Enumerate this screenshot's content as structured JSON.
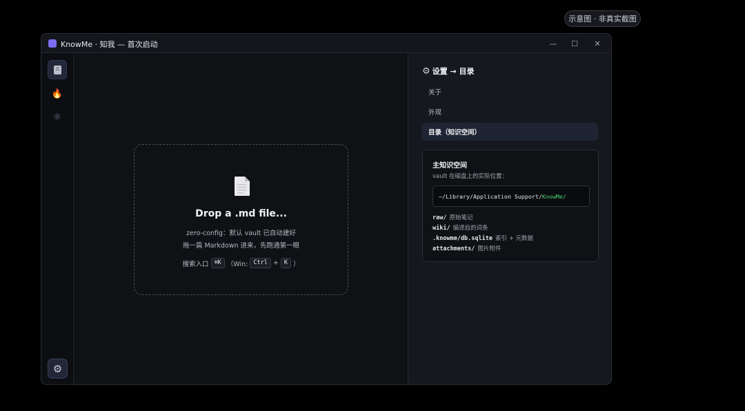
{
  "badge": {
    "text": "示意图 · 非真实截图"
  },
  "window": {
    "title": "KnowMe · 知我 — 首次启动",
    "accent_color": "#7b6cf2",
    "controls": {
      "minimize": "—",
      "maximize": "☐",
      "close": "✕"
    }
  },
  "rail": {
    "items": [
      {
        "icon": "book-icon",
        "active": true
      },
      {
        "icon": "flame-icon",
        "glyph": "🔥",
        "active": false
      },
      {
        "icon": "atom-icon",
        "glyph": "⚛",
        "active": false
      }
    ],
    "settings_glyph": "⚙"
  },
  "dropzone": {
    "title": "Drop a .md file...",
    "line1": "zero-config：默认 vault 已自动建好",
    "line2": "拖一篇 Markdown 进来，先跑通第一眼",
    "shortcut": {
      "prefix": "搜索入口",
      "key_mac": "⌘K",
      "win_open": "（Win:",
      "key_ctrl": "Ctrl",
      "plus": "+",
      "key_k": "K",
      "close": "）"
    }
  },
  "settings": {
    "gear_glyph": "⚙",
    "title": "设置 → 目录",
    "nav": [
      {
        "label": "关于",
        "active": false
      },
      {
        "label": "外观",
        "active": false
      },
      {
        "label": "目录（知识空间）",
        "active": true
      }
    ],
    "card": {
      "title": "主知识空间",
      "subtitle": "vault 在磁盘上的实际位置：",
      "path_prefix": "~/Library/Application Support/",
      "path_highlight": "KnowMe/",
      "highlight_color": "#4ed47a",
      "dirs": [
        {
          "name": "raw/",
          "desc": "原始笔记"
        },
        {
          "name": "wiki/",
          "desc": "编译后的词条"
        },
        {
          "name": ".knowme/db.sqlite",
          "desc": "索引 + 元数据"
        },
        {
          "name": "attachments/",
          "desc": "图片附件"
        }
      ]
    }
  }
}
